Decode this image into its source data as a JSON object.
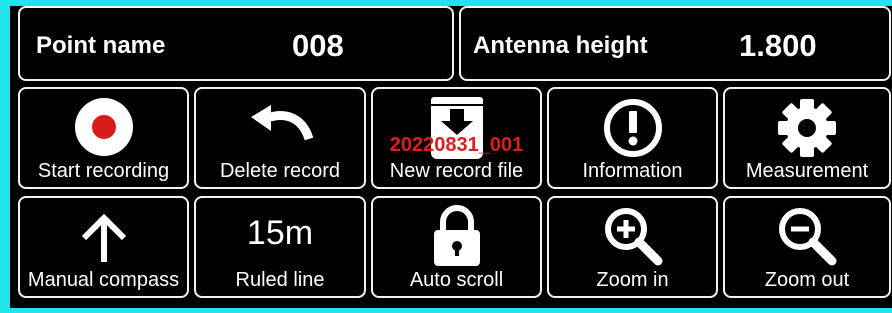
{
  "header": {
    "point_name_label": "Point name",
    "point_name_value": "008",
    "antenna_height_label": "Antenna height",
    "antenna_height_value": "1.800"
  },
  "tiles": [
    {
      "label": "Start recording",
      "icon": "record-icon"
    },
    {
      "label": "Delete record",
      "icon": "undo-icon"
    },
    {
      "label": "New record file",
      "icon": "download-icon",
      "overlay": "20220831_001"
    },
    {
      "label": "Information",
      "icon": "info-icon"
    },
    {
      "label": "Measurement",
      "icon": "gear-icon"
    },
    {
      "label": "Manual compass",
      "icon": "arrow-up-icon"
    },
    {
      "label": "Ruled line",
      "value": "15m"
    },
    {
      "label": "Auto scroll",
      "icon": "lock-icon"
    },
    {
      "label": "Zoom in",
      "icon": "zoom-in-icon"
    },
    {
      "label": "Zoom out",
      "icon": "zoom-out-icon"
    }
  ],
  "colors": {
    "background": "#22e3e8",
    "panel": "#000000",
    "border": "#f2f2f2",
    "record_dot": "#d81b1b",
    "overlay_text": "#e21b1b"
  }
}
